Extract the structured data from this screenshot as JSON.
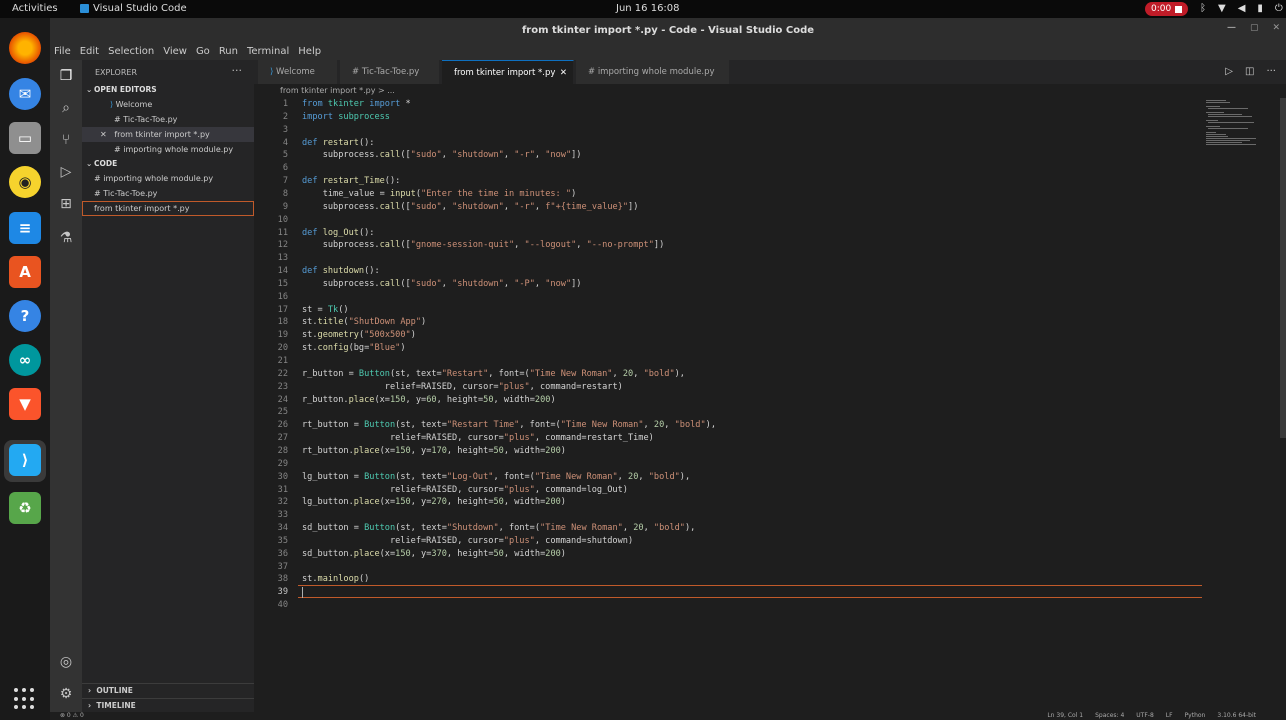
{
  "topbar": {
    "activities": "Activities",
    "app_name": "Visual Studio Code",
    "clock": "Jun 16  16:08",
    "recording": "0:00"
  },
  "window": {
    "title": "from tkinter import *.py - Code - Visual Studio Code"
  },
  "menu": [
    "File",
    "Edit",
    "Selection",
    "View",
    "Go",
    "Run",
    "Terminal",
    "Help"
  ],
  "sidebar": {
    "header": "EXPLORER",
    "open_editors_label": "OPEN EDITORS",
    "open_editors": [
      {
        "label": "Welcome"
      },
      {
        "label": "# Tic-Tac-Toe.py"
      },
      {
        "label": "from tkinter import *.py"
      },
      {
        "label": "# importing whole module.py"
      }
    ],
    "folder_label": "CODE",
    "files": [
      {
        "label": "# importing whole module.py"
      },
      {
        "label": "# Tic-Tac-Toe.py"
      },
      {
        "label": "from tkinter import *.py"
      }
    ],
    "outline": "OUTLINE",
    "timeline": "TIMELINE"
  },
  "tabs": [
    {
      "label": "Welcome"
    },
    {
      "label": "# Tic-Tac-Toe.py"
    },
    {
      "label": "from tkinter import *.py"
    },
    {
      "label": "# importing whole module.py"
    }
  ],
  "breadcrumb": "from tkinter import *.py > ...",
  "code": {
    "lines": [
      "1",
      "2",
      "3",
      "4",
      "5",
      "6",
      "7",
      "8",
      "9",
      "10",
      "11",
      "12",
      "13",
      "14",
      "15",
      "16",
      "17",
      "18",
      "19",
      "20",
      "21",
      "22",
      "23",
      "24",
      "25",
      "26",
      "27",
      "28",
      "29",
      "30",
      "31",
      "32",
      "33",
      "34",
      "35",
      "36",
      "37",
      "38",
      "39",
      "40"
    ],
    "text": {
      "l1a": "from",
      "l1b": " tkinter ",
      "l1c": "import",
      "l1d": " *",
      "l2a": "import",
      "l2b": " subprocess",
      "l4a": "def",
      "l4b": " restart",
      "l4c": "():",
      "l5a": "    subprocess.",
      "l5b": "call",
      "l5c": "([",
      "l5d": "\"sudo\"",
      "l5e": ", ",
      "l5f": "\"shutdown\"",
      "l5g": ", ",
      "l5h": "\"-r\"",
      "l5i": ", ",
      "l5j": "\"now\"",
      "l5k": "])",
      "l7a": "def",
      "l7b": " restart_Time",
      "l7c": "():",
      "l8a": "    time_value = ",
      "l8b": "input",
      "l8c": "(",
      "l8d": "\"Enter the time in minutes: \"",
      "l8e": ")",
      "l9a": "    subprocess.",
      "l9b": "call",
      "l9c": "([",
      "l9d": "\"sudo\"",
      "l9e": ", ",
      "l9f": "\"shutdown\"",
      "l9g": ", ",
      "l9h": "\"-r\"",
      "l9i": ", ",
      "l9j": "f\"+{time_value}\"",
      "l9k": "])",
      "l11a": "def",
      "l11b": " log_Out",
      "l11c": "():",
      "l12a": "    subprocess.",
      "l12b": "call",
      "l12c": "([",
      "l12d": "\"gnome-session-quit\"",
      "l12e": ", ",
      "l12f": "\"--logout\"",
      "l12g": ", ",
      "l12h": "\"--no-prompt\"",
      "l12i": "])",
      "l14a": "def",
      "l14b": " shutdown",
      "l14c": "():",
      "l15a": "    subprocess.",
      "l15b": "call",
      "l15c": "([",
      "l15d": "\"sudo\"",
      "l15e": ", ",
      "l15f": "\"shutdown\"",
      "l15g": ", ",
      "l15h": "\"-P\"",
      "l15i": ", ",
      "l15j": "\"now\"",
      "l15k": "])",
      "l17a": "st = ",
      "l17b": "Tk",
      "l17c": "()",
      "l18a": "st.",
      "l18b": "title",
      "l18c": "(",
      "l18d": "\"ShutDown App\"",
      "l18e": ")",
      "l19a": "st.",
      "l19b": "geometry",
      "l19c": "(",
      "l19d": "\"500x500\"",
      "l19e": ")",
      "l20a": "st.",
      "l20b": "config",
      "l20c": "(bg=",
      "l20d": "\"Blue\"",
      "l20e": ")",
      "l22a": "r_button = ",
      "l22b": "Button",
      "l22c": "(st, text=",
      "l22d": "\"Restart\"",
      "l22e": ", font=(",
      "l22f": "\"Time New Roman\"",
      "l22g": ", ",
      "l22h": "20",
      "l22i": ", ",
      "l22j": "\"bold\"",
      "l22k": "),",
      "l23a": "                relief=RAISED, cursor=",
      "l23b": "\"plus\"",
      "l23c": ", command=restart)",
      "l24a": "r_button.",
      "l24b": "place",
      "l24c": "(x=",
      "l24d": "150",
      "l24e": ", y=",
      "l24f": "60",
      "l24g": ", height=",
      "l24h": "50",
      "l24i": ", width=",
      "l24j": "200",
      "l24k": ")",
      "l26a": "rt_button = ",
      "l26b": "Button",
      "l26c": "(st, text=",
      "l26d": "\"Restart Time\"",
      "l26e": ", font=(",
      "l26f": "\"Time New Roman\"",
      "l26g": ", ",
      "l26h": "20",
      "l26i": ", ",
      "l26j": "\"bold\"",
      "l26k": "),",
      "l27a": "                 relief=RAISED, cursor=",
      "l27b": "\"plus\"",
      "l27c": ", command=restart_Time)",
      "l28a": "rt_button.",
      "l28b": "place",
      "l28c": "(x=",
      "l28d": "150",
      "l28e": ", y=",
      "l28f": "170",
      "l28g": ", height=",
      "l28h": "50",
      "l28i": ", width=",
      "l28j": "200",
      "l28k": ")",
      "l30a": "lg_button = ",
      "l30b": "Button",
      "l30c": "(st, text=",
      "l30d": "\"Log-Out\"",
      "l30e": ", font=(",
      "l30f": "\"Time New Roman\"",
      "l30g": ", ",
      "l30h": "20",
      "l30i": ", ",
      "l30j": "\"bold\"",
      "l30k": "),",
      "l31a": "                 relief=RAISED, cursor=",
      "l31b": "\"plus\"",
      "l31c": ", command=log_Out)",
      "l32a": "lg_button.",
      "l32b": "place",
      "l32c": "(x=",
      "l32d": "150",
      "l32e": ", y=",
      "l32f": "270",
      "l32g": ", height=",
      "l32h": "50",
      "l32i": ", width=",
      "l32j": "200",
      "l32k": ")",
      "l34a": "sd_button = ",
      "l34b": "Button",
      "l34c": "(st, text=",
      "l34d": "\"Shutdown\"",
      "l34e": ", font=(",
      "l34f": "\"Time New Roman\"",
      "l34g": ", ",
      "l34h": "20",
      "l34i": ", ",
      "l34j": "\"bold\"",
      "l34k": "),",
      "l35a": "                 relief=RAISED, cursor=",
      "l35b": "\"plus\"",
      "l35c": ", command=shutdown)",
      "l36a": "sd_button.",
      "l36b": "place",
      "l36c": "(x=",
      "l36d": "150",
      "l36e": ", y=",
      "l36f": "370",
      "l36g": ", height=",
      "l36h": "50",
      "l36i": ", width=",
      "l36j": "200",
      "l36k": ")",
      "l38a": "st.",
      "l38b": "mainloop",
      "l38c": "()"
    }
  },
  "status": {
    "left": "⊗ 0  ⚠ 0",
    "position": "Ln 39, Col 1",
    "spaces": "Spaces: 4",
    "encoding": "UTF-8",
    "eol": "LF",
    "language": "Python",
    "interpreter": "3.10.6 64-bit"
  },
  "colors": {
    "accent": "#0e70c0",
    "cursor_line": "#c05a2a"
  }
}
